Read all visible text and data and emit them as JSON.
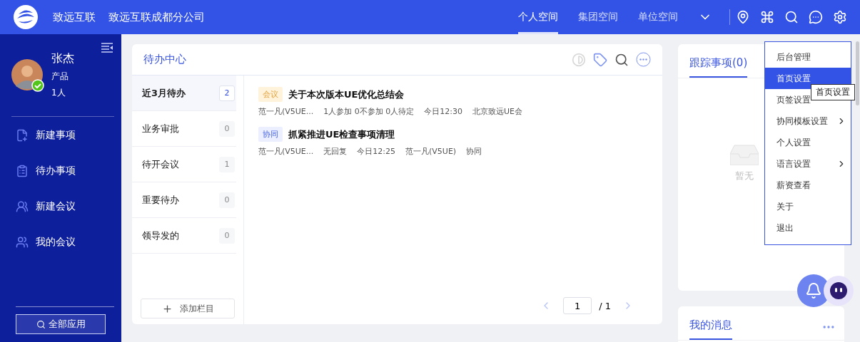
{
  "header": {
    "brand": "致远互联",
    "company": "致远互联成都分公司",
    "nav": [
      {
        "label": "个人空间",
        "selected": true
      },
      {
        "label": "集团空间",
        "selected": false
      },
      {
        "label": "单位空间",
        "selected": false
      }
    ]
  },
  "sidebar": {
    "user": {
      "name": "张杰",
      "role": "产品",
      "count": "1人",
      "online": true
    },
    "items": [
      {
        "label": "新建事项",
        "kind": "new-item"
      },
      {
        "label": "待办事项",
        "kind": "todo"
      },
      {
        "label": "新建会议",
        "kind": "new-meeting"
      },
      {
        "label": "我的会议",
        "kind": "meetings"
      }
    ],
    "all_apps_button": "全部应用"
  },
  "todo_card": {
    "title": "待办中心",
    "categories": [
      {
        "label": "近3月待办",
        "count": "2",
        "selected": true
      },
      {
        "label": "业务审批",
        "count": "0",
        "selected": false
      },
      {
        "label": "待开会议",
        "count": "1",
        "selected": false
      },
      {
        "label": "重要待办",
        "count": "0",
        "selected": false
      },
      {
        "label": "领导发的",
        "count": "0",
        "selected": false
      }
    ],
    "add_button": "添加栏目",
    "items": [
      {
        "tag": "会议",
        "kind": "meeting",
        "title": "关于本次版本UE优化总结会",
        "meta": [
          "范一凡(V5UE...",
          "1人参加 0不参加 0人待定",
          "今日12:30",
          "北京致远UE会"
        ]
      },
      {
        "tag": "协同",
        "kind": "collab",
        "title": "抓紧推进UE检查事项清理",
        "meta": [
          "范一凡(V5UE...",
          "无回复",
          "今日12:25",
          "范一凡(V5UE)",
          "协同"
        ]
      }
    ],
    "pagination": {
      "page": "1",
      "total": "/ 1"
    }
  },
  "tracking_card": {
    "tab": "跟踪事项(0)",
    "empty_text": "暂无"
  },
  "messages_card": {
    "title": "我的消息"
  },
  "settings_menu": {
    "items": [
      {
        "label": "后台管理",
        "submenu": false,
        "selected": false
      },
      {
        "label": "首页设置",
        "submenu": false,
        "selected": true
      },
      {
        "label": "页签设置",
        "submenu": false,
        "selected": false
      },
      {
        "label": "协同模板设置",
        "submenu": true,
        "selected": false
      },
      {
        "label": "个人设置",
        "submenu": false,
        "selected": false
      },
      {
        "label": "语言设置",
        "submenu": true,
        "selected": false
      },
      {
        "label": "薪资查看",
        "submenu": false,
        "selected": false
      },
      {
        "label": "关于",
        "submenu": false,
        "selected": false
      },
      {
        "label": "退出",
        "submenu": false,
        "selected": false
      }
    ],
    "tooltip": "首页设置"
  }
}
